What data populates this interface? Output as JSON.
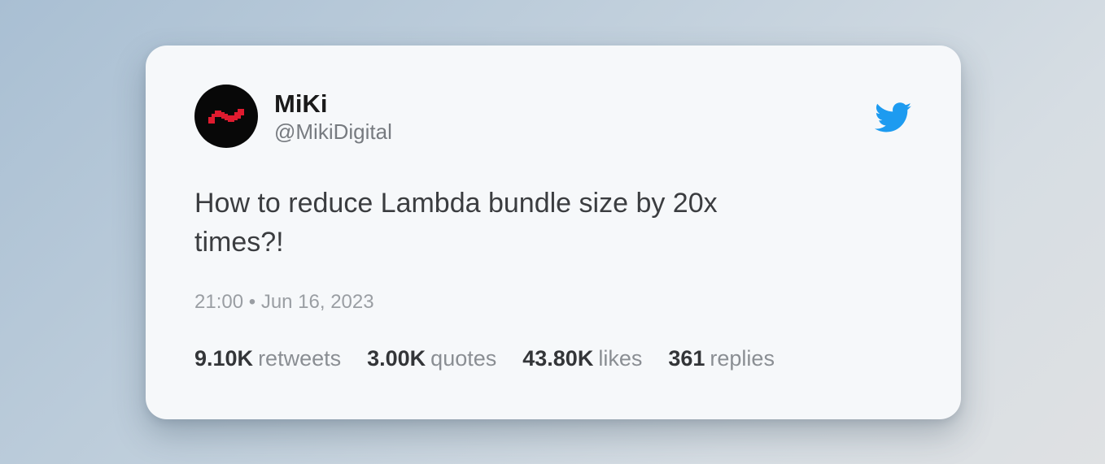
{
  "author": {
    "name": "MiKi",
    "handle": "@MikiDigital",
    "avatar_icon": "pixel-wave-logo",
    "avatar_bg": "#080808",
    "avatar_accent": "#e01b2f"
  },
  "brand": {
    "icon": "twitter-bird-icon",
    "color": "#1d9bf0"
  },
  "tweet": {
    "text": "How to reduce Lambda bundle size by 20x times?!",
    "time": "21:00",
    "separator": "•",
    "date": "Jun 16, 2023"
  },
  "stats": [
    {
      "value": "9.10K",
      "label": "retweets"
    },
    {
      "value": "3.00K",
      "label": "quotes"
    },
    {
      "value": "43.80K",
      "label": "likes"
    },
    {
      "value": "361",
      "label": "replies"
    }
  ]
}
